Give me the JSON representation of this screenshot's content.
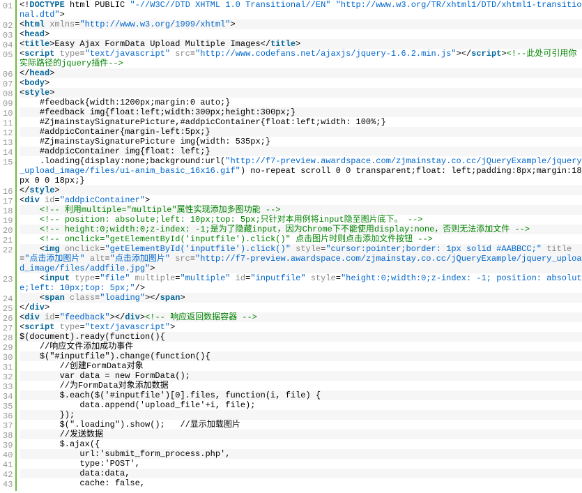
{
  "lines": [
    {
      "n": "01",
      "t": [
        [
          "pu",
          "<!"
        ],
        [
          "t",
          "DOCTYPE"
        ],
        [
          "p",
          " html PUBLIC "
        ],
        [
          "s",
          "\"-//W3C//DTD XHTML 1.0 Transitional//EN\" \"http://www.w3.org/TR/xhtml1/DTD/xhtml1-transitional.dtd\""
        ],
        [
          "pu",
          ">"
        ]
      ]
    },
    {
      "n": "02",
      "t": [
        [
          "pu",
          "<"
        ],
        [
          "t",
          "html"
        ],
        [
          "p",
          " "
        ],
        [
          "a",
          "xmlns"
        ],
        [
          "p",
          "="
        ],
        [
          "s",
          "\"http://www.w3.org/1999/xhtml\""
        ],
        [
          "pu",
          ">"
        ]
      ]
    },
    {
      "n": "03",
      "t": [
        [
          "pu",
          "<"
        ],
        [
          "t",
          "head"
        ],
        [
          "pu",
          ">"
        ]
      ]
    },
    {
      "n": "04",
      "t": [
        [
          "pu",
          "<"
        ],
        [
          "t",
          "title"
        ],
        [
          "pu",
          ">"
        ],
        [
          "p",
          "Easy Ajax FormData Upload Multiple Images"
        ],
        [
          "pu",
          "</"
        ],
        [
          "t",
          "title"
        ],
        [
          "pu",
          ">"
        ]
      ]
    },
    {
      "n": "05",
      "t": [
        [
          "pu",
          "<"
        ],
        [
          "t",
          "script"
        ],
        [
          "p",
          " "
        ],
        [
          "a",
          "type"
        ],
        [
          "p",
          "="
        ],
        [
          "s",
          "\"text/javascript\""
        ],
        [
          "p",
          " "
        ],
        [
          "a",
          "src"
        ],
        [
          "p",
          "="
        ],
        [
          "s",
          "\"http://www.codefans.net/ajaxjs/jquery-1.6.2.min.js\""
        ],
        [
          "pu",
          "></"
        ],
        [
          "t",
          "script"
        ],
        [
          "pu",
          ">"
        ],
        [
          "c",
          "<!--此处可引用你实际路径的jquery插件-->"
        ]
      ]
    },
    {
      "n": "06",
      "t": [
        [
          "pu",
          "</"
        ],
        [
          "t",
          "head"
        ],
        [
          "pu",
          ">"
        ]
      ]
    },
    {
      "n": "07",
      "t": [
        [
          "pu",
          "<"
        ],
        [
          "t",
          "body"
        ],
        [
          "pu",
          ">"
        ]
      ]
    },
    {
      "n": "08",
      "t": [
        [
          "pu",
          "<"
        ],
        [
          "t",
          "style"
        ],
        [
          "pu",
          ">"
        ]
      ]
    },
    {
      "n": "09",
      "t": [
        [
          "p",
          "    #feedback{width:1200px;margin:0 auto;}"
        ]
      ]
    },
    {
      "n": "10",
      "t": [
        [
          "p",
          "    #feedback img{float:left;width:300px;height:300px;}"
        ]
      ]
    },
    {
      "n": "11",
      "t": [
        [
          "p",
          "    #ZjmainstaySignaturePicture,#addpicContainer{float:left;width: 100%;}"
        ]
      ]
    },
    {
      "n": "12",
      "t": [
        [
          "p",
          "    #addpicContainer{margin-left:5px;}"
        ]
      ]
    },
    {
      "n": "13",
      "t": [
        [
          "p",
          "    #ZjmainstaySignaturePicture img{width: 535px;}"
        ]
      ]
    },
    {
      "n": "14",
      "t": [
        [
          "p",
          "    #addpicContainer img{float: left;}"
        ]
      ]
    },
    {
      "n": "15",
      "t": [
        [
          "p",
          "    .loading{display:none;background:url("
        ],
        [
          "s",
          "\"http://f7-preview.awardspace.com/zjmainstay.co.cc/jQueryExample/jquery_upload_image/files/ui-anim_basic_16x16.gif\""
        ],
        [
          "p",
          ") no-repeat scroll 0 0 transparent;float: left;padding:8px;margin:18px 0 0 18px;}"
        ]
      ]
    },
    {
      "n": "16",
      "t": [
        [
          "pu",
          "</"
        ],
        [
          "t",
          "style"
        ],
        [
          "pu",
          ">"
        ]
      ]
    },
    {
      "n": "17",
      "t": [
        [
          "pu",
          "<"
        ],
        [
          "t",
          "div"
        ],
        [
          "p",
          " "
        ],
        [
          "a",
          "id"
        ],
        [
          "p",
          "="
        ],
        [
          "s",
          "\"addpicContainer\""
        ],
        [
          "pu",
          ">"
        ]
      ]
    },
    {
      "n": "18",
      "t": [
        [
          "p",
          "    "
        ],
        [
          "c",
          "<!-- 利用multiple=\"multiple\"属性实现添加多图功能 -->"
        ]
      ]
    },
    {
      "n": "19",
      "t": [
        [
          "p",
          "    "
        ],
        [
          "c",
          "<!-- position: absolute;left: 10px;top: 5px;只针对本用例将input隐至图片底下。 -->"
        ]
      ]
    },
    {
      "n": "20",
      "t": [
        [
          "p",
          "    "
        ],
        [
          "c",
          "<!-- height:0;width:0;z-index: -1;是为了隐藏input，因为Chrome下不能使用display:none，否则无法添加文件 -->"
        ]
      ]
    },
    {
      "n": "21",
      "t": [
        [
          "p",
          "    "
        ],
        [
          "c",
          "<!-- onclick=\"getElementById('inputfile').click()\" 点击图片时则点击添加文件按钮 -->"
        ]
      ]
    },
    {
      "n": "22",
      "t": [
        [
          "p",
          "    "
        ],
        [
          "pu",
          "<"
        ],
        [
          "t",
          "img"
        ],
        [
          "p",
          " "
        ],
        [
          "a",
          "onclick"
        ],
        [
          "p",
          "="
        ],
        [
          "s",
          "\"getElementById('inputfile').click()\""
        ],
        [
          "p",
          " "
        ],
        [
          "a",
          "style"
        ],
        [
          "p",
          "="
        ],
        [
          "s",
          "\"cursor:pointer;border: 1px solid #AABBCC;\""
        ],
        [
          "p",
          " "
        ],
        [
          "a",
          "title"
        ],
        [
          "p",
          "="
        ],
        [
          "s",
          "\"点击添加图片\""
        ],
        [
          "p",
          " "
        ],
        [
          "a",
          "alt"
        ],
        [
          "p",
          "="
        ],
        [
          "s",
          "\"点击添加图片\""
        ],
        [
          "p",
          " "
        ],
        [
          "a",
          "src"
        ],
        [
          "p",
          "="
        ],
        [
          "s",
          "\"http://f7-preview.awardspace.com/zjmainstay.co.cc/jQueryExample/jquery_upload_image/files/addfile.jpg\""
        ],
        [
          "pu",
          ">"
        ]
      ]
    },
    {
      "n": "23",
      "t": [
        [
          "p",
          "    "
        ],
        [
          "pu",
          "<"
        ],
        [
          "t",
          "input"
        ],
        [
          "p",
          " "
        ],
        [
          "a",
          "type"
        ],
        [
          "p",
          "="
        ],
        [
          "s",
          "\"file\""
        ],
        [
          "p",
          " "
        ],
        [
          "a",
          "multiple"
        ],
        [
          "p",
          "="
        ],
        [
          "s",
          "\"multiple\""
        ],
        [
          "p",
          " "
        ],
        [
          "a",
          "id"
        ],
        [
          "p",
          "="
        ],
        [
          "s",
          "\"inputfile\""
        ],
        [
          "p",
          " "
        ],
        [
          "a",
          "style"
        ],
        [
          "p",
          "="
        ],
        [
          "s",
          "\"height:0;width:0;z-index: -1; position: absolute;left: 10px;top: 5px;\""
        ],
        [
          "pu",
          "/>"
        ]
      ]
    },
    {
      "n": "24",
      "t": [
        [
          "p",
          "    "
        ],
        [
          "pu",
          "<"
        ],
        [
          "t",
          "span"
        ],
        [
          "p",
          " "
        ],
        [
          "a",
          "class"
        ],
        [
          "p",
          "="
        ],
        [
          "s",
          "\"loading\""
        ],
        [
          "pu",
          "></"
        ],
        [
          "t",
          "span"
        ],
        [
          "pu",
          ">"
        ]
      ]
    },
    {
      "n": "25",
      "t": [
        [
          "pu",
          "</"
        ],
        [
          "t",
          "div"
        ],
        [
          "pu",
          ">"
        ]
      ]
    },
    {
      "n": "26",
      "t": [
        [
          "pu",
          "<"
        ],
        [
          "t",
          "div"
        ],
        [
          "p",
          " "
        ],
        [
          "a",
          "id"
        ],
        [
          "p",
          "="
        ],
        [
          "s",
          "\"feedback\""
        ],
        [
          "pu",
          "></"
        ],
        [
          "t",
          "div"
        ],
        [
          "pu",
          ">"
        ],
        [
          "c",
          "<!-- 响应返回数据容器 -->"
        ]
      ]
    },
    {
      "n": "27",
      "t": [
        [
          "pu",
          "<"
        ],
        [
          "t",
          "script"
        ],
        [
          "p",
          " "
        ],
        [
          "a",
          "type"
        ],
        [
          "p",
          "="
        ],
        [
          "s",
          "\"text/javascript\""
        ],
        [
          "pu",
          ">"
        ]
      ]
    },
    {
      "n": "28",
      "t": [
        [
          "p",
          "$(document).ready(function(){"
        ]
      ]
    },
    {
      "n": "29",
      "t": [
        [
          "p",
          "    //响应文件添加成功事件"
        ]
      ]
    },
    {
      "n": "30",
      "t": [
        [
          "p",
          "    $(\"#inputfile\").change(function(){"
        ]
      ]
    },
    {
      "n": "31",
      "t": [
        [
          "p",
          "        //创建FormData对象"
        ]
      ]
    },
    {
      "n": "32",
      "t": [
        [
          "p",
          "        var data = new FormData();"
        ]
      ]
    },
    {
      "n": "33",
      "t": [
        [
          "p",
          "        //为FormData对象添加数据"
        ]
      ]
    },
    {
      "n": "34",
      "t": [
        [
          "p",
          "        $.each($('#inputfile')[0].files, function(i, file) {"
        ]
      ]
    },
    {
      "n": "35",
      "t": [
        [
          "p",
          "            data.append('upload_file'+i, file);"
        ]
      ]
    },
    {
      "n": "36",
      "t": [
        [
          "p",
          "        });"
        ]
      ]
    },
    {
      "n": "37",
      "t": [
        [
          "p",
          "        $(\".loading\").show();   //显示加载图片"
        ]
      ]
    },
    {
      "n": "38",
      "t": [
        [
          "p",
          "        //发送数据"
        ]
      ]
    },
    {
      "n": "39",
      "t": [
        [
          "p",
          "        $.ajax({"
        ]
      ]
    },
    {
      "n": "40",
      "t": [
        [
          "p",
          "            url:'submit_form_process.php',"
        ]
      ]
    },
    {
      "n": "41",
      "t": [
        [
          "p",
          "            type:'POST',"
        ]
      ]
    },
    {
      "n": "42",
      "t": [
        [
          "p",
          "            data:data,"
        ]
      ]
    },
    {
      "n": "43",
      "t": [
        [
          "p",
          "            cache: false,"
        ]
      ]
    }
  ]
}
